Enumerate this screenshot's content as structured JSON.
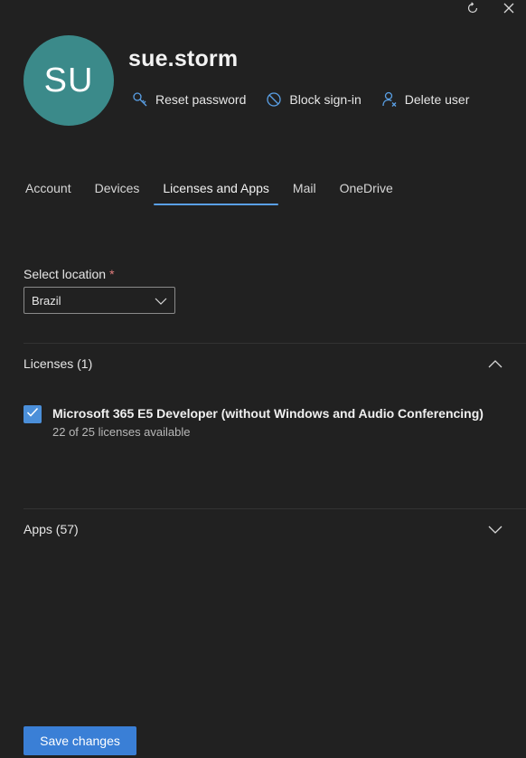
{
  "user": {
    "initials": "SU",
    "name": "sue.storm",
    "avatar_color": "#3b8a8a"
  },
  "header_actions": {
    "refresh_icon": "refresh-icon",
    "close_icon": "close-icon"
  },
  "user_actions": [
    {
      "label": "Reset password",
      "icon": "key-icon"
    },
    {
      "label": "Block sign-in",
      "icon": "block-icon"
    },
    {
      "label": "Delete user",
      "icon": "delete-user-icon"
    }
  ],
  "tabs": [
    {
      "label": "Account",
      "active": false
    },
    {
      "label": "Devices",
      "active": false
    },
    {
      "label": "Licenses and Apps",
      "active": true
    },
    {
      "label": "Mail",
      "active": false
    },
    {
      "label": "OneDrive",
      "active": false
    }
  ],
  "location": {
    "label": "Select location",
    "required_marker": "*",
    "value": "Brazil"
  },
  "licenses": {
    "header": "Licenses (1)",
    "expanded": true,
    "items": [
      {
        "name": "Microsoft 365 E5 Developer (without Windows and Audio Conferencing)",
        "availability": "22 of 25 licenses available",
        "checked": true
      }
    ]
  },
  "apps": {
    "header": "Apps (57)",
    "expanded": false
  },
  "footer": {
    "save_label": "Save changes"
  },
  "colors": {
    "background": "#212121",
    "accent": "#3a7fd6",
    "tab_underline": "#5aa0e6",
    "required": "#e37d7d"
  }
}
